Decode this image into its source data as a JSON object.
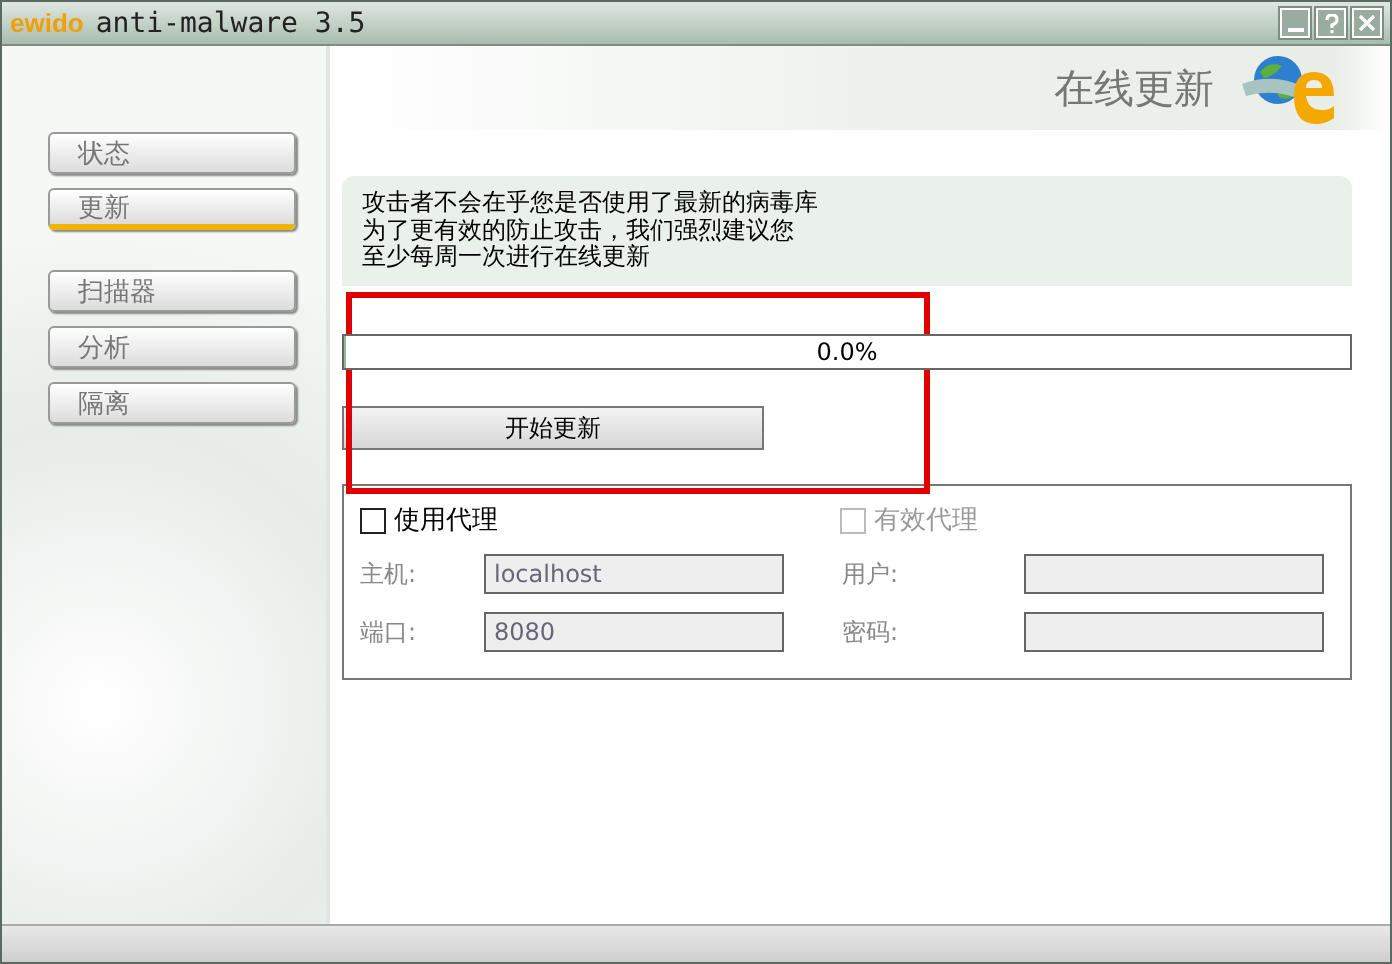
{
  "window": {
    "logo": "ewido",
    "title": "anti-malware 3.5",
    "controls": [
      {
        "kind": "minimize"
      },
      {
        "kind": "help"
      },
      {
        "kind": "close"
      }
    ]
  },
  "header": {
    "title": "在线更新"
  },
  "nav_groups": [
    [
      {
        "label": "状态",
        "selected": false
      },
      {
        "label": "更新",
        "selected": true
      }
    ],
    [
      {
        "label": "扫描器",
        "selected": false
      },
      {
        "label": "分析",
        "selected": false
      },
      {
        "label": "隔离",
        "selected": false
      }
    ]
  ],
  "info": [
    "攻击者不会在乎您是否使用了最新的病毒库",
    "为了更有效的防止攻击，我们强烈建议您",
    "至少每周一次进行在线更新"
  ],
  "progress": {
    "level": 0,
    "reading": "0.0%"
  },
  "update_button": "开始更新",
  "proxy": {
    "checkboxes": [
      {
        "label": "使用代理",
        "checked": false,
        "disabled": false
      },
      {
        "label": "有效代理",
        "checked": false,
        "disabled": true
      }
    ],
    "fields": [
      {
        "label": "主机:",
        "value": "localhost",
        "disabled": true
      },
      {
        "label": "用户:",
        "disabled": true
      },
      {
        "label": "端口:",
        "value": "8080",
        "disabled": true
      },
      {
        "label": "密码:",
        "disabled": true
      }
    ]
  }
}
